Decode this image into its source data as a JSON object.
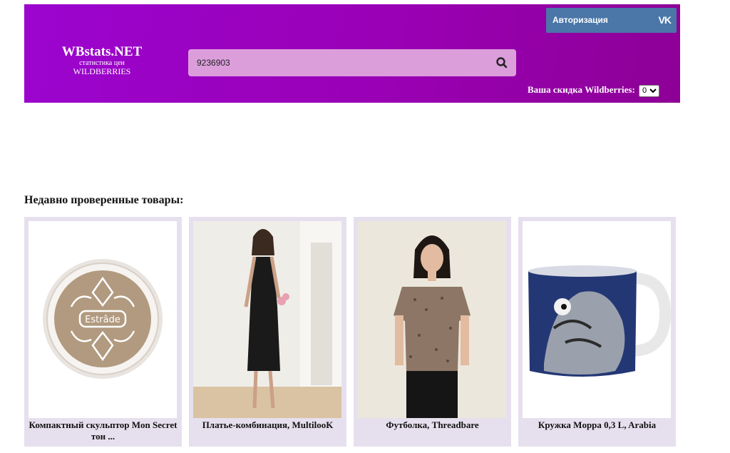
{
  "header": {
    "logo_title": "WBstats.NET",
    "logo_subtitle": "статистика цен",
    "logo_subtitle2": "WILDBERRIES",
    "search_value": "9236903",
    "search_icon": "search-icon",
    "auth_label": "Авторизация",
    "auth_icon": "vk-icon",
    "auth_icon_text": "VK",
    "discount_label": "Ваша скидка Wildberries:",
    "discount_value": "0",
    "colors": {
      "header_gradient_start": "#9b05cf",
      "header_gradient_end": "#8d0096",
      "search_bg": "#dc9edb",
      "auth_bg": "#4a76a8"
    }
  },
  "recent": {
    "title": "Недавно проверенные товары:",
    "items": [
      {
        "name": "Компактный скульптор Mon Secret тон ...",
        "image": "estrade-compact-sculptor",
        "image_text": "Estrâde"
      },
      {
        "name": "Платье-комбинация, MultilooK",
        "image": "woman-black-slip-dress"
      },
      {
        "name": "Футболка, Threadbare",
        "image": "woman-leopard-tshirt"
      },
      {
        "name": "Кружка Moppa 0,3 L, Arabia",
        "image": "moomin-mug"
      }
    ]
  }
}
